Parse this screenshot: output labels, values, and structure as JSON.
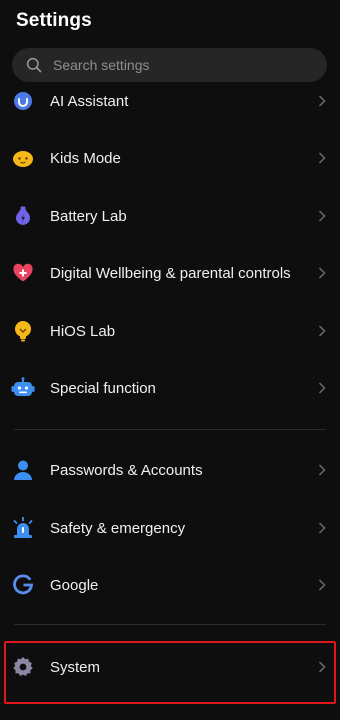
{
  "header": {
    "title": "Settings"
  },
  "search": {
    "placeholder": "Search settings",
    "value": ""
  },
  "items": [
    {
      "label": "AI Assistant",
      "icon": "ai-assistant-icon"
    },
    {
      "label": "Kids Mode",
      "icon": "kids-mode-icon"
    },
    {
      "label": "Battery Lab",
      "icon": "battery-lab-icon"
    },
    {
      "label": "Digital Wellbeing & parental controls",
      "icon": "heart-icon"
    },
    {
      "label": "HiOS Lab",
      "icon": "lightbulb-icon"
    },
    {
      "label": "Special function",
      "icon": "robot-icon"
    },
    {
      "label": "Passwords & Accounts",
      "icon": "person-icon"
    },
    {
      "label": "Safety & emergency",
      "icon": "siren-icon"
    },
    {
      "label": "Google",
      "icon": "google-icon"
    },
    {
      "label": "System",
      "icon": "gear-icon"
    }
  ],
  "colors": {
    "background": "#0e0e0e",
    "highlight_border": "#e0161b",
    "accent_blue": "#5b8def",
    "accent_yellow": "#f7b500",
    "accent_purple": "#6f63e8",
    "accent_pink": "#e9435f"
  }
}
